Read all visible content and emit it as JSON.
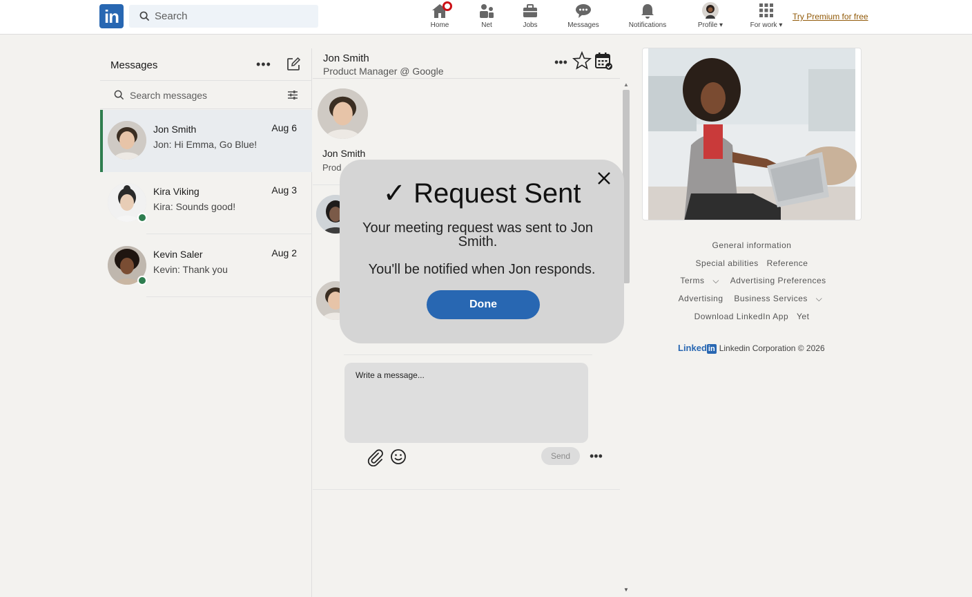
{
  "nav": {
    "logo_text": "in",
    "search_placeholder": "Search",
    "items": [
      {
        "label": "Home",
        "icon": "home-icon"
      },
      {
        "label": "Net",
        "icon": "network-icon"
      },
      {
        "label": "Jobs",
        "icon": "briefcase-icon"
      },
      {
        "label": "Messages",
        "icon": "messages-icon"
      },
      {
        "label": "Notifications",
        "icon": "bell-icon"
      },
      {
        "label": "Profile",
        "icon": "avatar"
      },
      {
        "label": "For work",
        "icon": "grid-icon"
      }
    ],
    "premium_link": "Try Premium for free"
  },
  "messages": {
    "title": "Messages",
    "search_placeholder": "Search messages",
    "conversations": [
      {
        "name": "Jon Smith",
        "date": "Aug 6",
        "preview": "Jon:  Hi Emma, Go Blue!",
        "active": true,
        "online": false
      },
      {
        "name": "Kira Viking",
        "date": "Aug 3",
        "preview": "Kira:  Sounds good!",
        "active": false,
        "online": true
      },
      {
        "name": "Kevin Saler",
        "date": "Aug 2",
        "preview": "Kevin:  Thank you",
        "active": false,
        "online": true
      }
    ]
  },
  "chat": {
    "name": "Jon Smith",
    "headline": "Product Manager @ Google",
    "profile_name": "Jon Smith",
    "profile_headline_partial": "Prod",
    "composer_placeholder": "Write a message...",
    "send_label": "Send"
  },
  "modal": {
    "title": "✓ Request Sent",
    "line1": "Your meeting request was sent to Jon Smith.",
    "line2": "You'll be notified when Jon responds.",
    "done_label": "Done"
  },
  "footer": {
    "row1": [
      "General information"
    ],
    "row2": [
      "Special abilities",
      "Reference"
    ],
    "row3": [
      "Terms",
      "Advertising Preferences"
    ],
    "row4": [
      "Advertising",
      "Business Services"
    ],
    "row5": [
      "Download LinkedIn App",
      "Yet"
    ],
    "brand_word": "Linked",
    "brand_in": "in",
    "copyright": "Linkedin Corporation © 2026"
  },
  "colors": {
    "brand": "#2867b2",
    "online": "#2e7d4f",
    "notification_badge": "#cc1016",
    "premium": "#915907"
  }
}
